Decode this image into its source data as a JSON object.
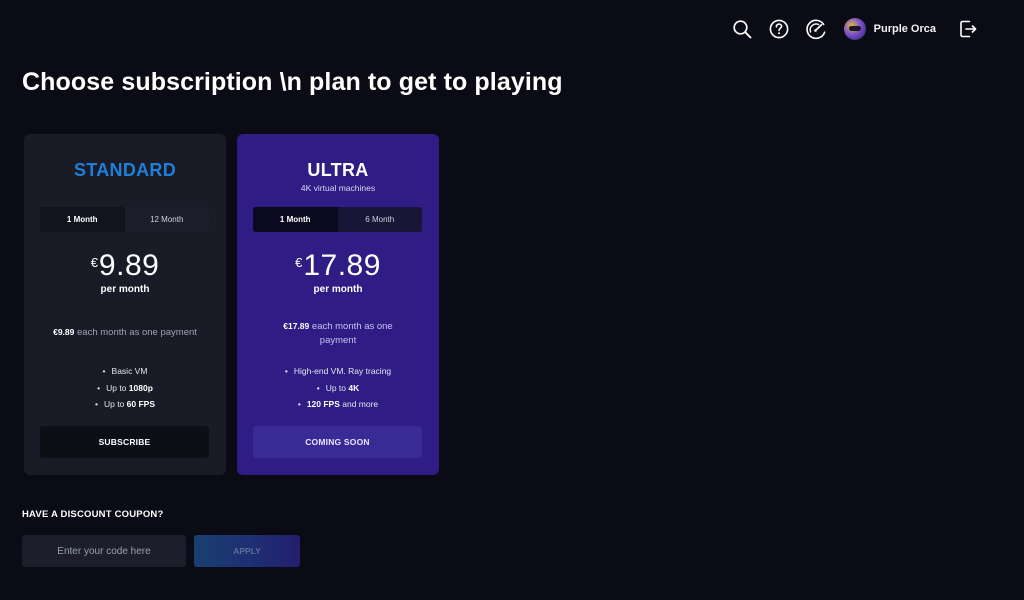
{
  "header": {
    "icons": [
      "search-icon",
      "help-icon",
      "speedometer-icon",
      "logout-icon"
    ],
    "user_name": "Purple Orca"
  },
  "page": {
    "title": "Choose subscription \\n plan to get to playing"
  },
  "plans": [
    {
      "name": "STANDARD",
      "subtitle": "",
      "accent_color": "#1f7fd8",
      "durations": [
        "1 Month",
        "12 Month"
      ],
      "selected_duration": "1 Month",
      "currency": "€",
      "price": "9.89",
      "period": "per month",
      "payment_amount": "€9.89",
      "payment_text": "each month as one payment",
      "features": [
        {
          "text": "Basic VM",
          "bold": ""
        },
        {
          "text": "Up to ",
          "bold": "1080p"
        },
        {
          "text": "Up to ",
          "bold": "60 FPS"
        }
      ],
      "button_label": "SUBSCRIBE"
    },
    {
      "name": "ULTRA",
      "subtitle": "4K virtual machines",
      "accent_color": "#2f1c84",
      "durations": [
        "1 Month",
        "6 Month"
      ],
      "selected_duration": "1 Month",
      "currency": "€",
      "price": "17.89",
      "period": "per month",
      "payment_amount": "€17.89",
      "payment_text": "each month as one payment",
      "features": [
        {
          "text": "High-end VM. Ray tracing",
          "bold": ""
        },
        {
          "text": "Up to ",
          "bold": "4K"
        },
        {
          "text": " and more",
          "bold": "120 FPS",
          "bold_first": true
        }
      ],
      "button_label": "COMING SOON"
    }
  ],
  "coupon": {
    "label": "HAVE A DISCOUNT COUPON?",
    "placeholder": "Enter your code here",
    "value": "",
    "apply_label": "APPLY"
  }
}
